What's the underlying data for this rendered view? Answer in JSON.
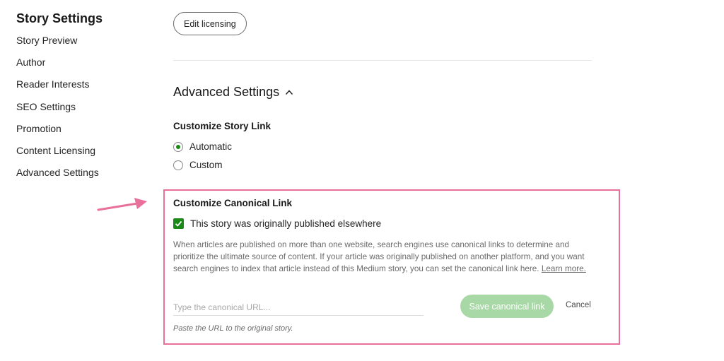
{
  "sidebar": {
    "title": "Story Settings",
    "items": [
      {
        "label": "Story Preview"
      },
      {
        "label": "Author"
      },
      {
        "label": "Reader Interests"
      },
      {
        "label": "SEO Settings"
      },
      {
        "label": "Promotion"
      },
      {
        "label": "Content Licensing"
      },
      {
        "label": "Advanced Settings"
      }
    ]
  },
  "main": {
    "edit_licensing_label": "Edit licensing",
    "advanced_settings_title": "Advanced Settings",
    "customize_story_link": {
      "title": "Customize Story Link",
      "options": [
        {
          "label": "Automatic",
          "selected": true
        },
        {
          "label": "Custom",
          "selected": false
        }
      ]
    },
    "canonical": {
      "title": "Customize Canonical Link",
      "checkbox_label": "This story was originally published elsewhere",
      "checkbox_checked": true,
      "description": "When articles are published on more than one website, search engines use canonical links to determine and prioritize the ultimate source of content. If your article was originally published on another platform, and you want search engines to index that article instead of this Medium story, you can set the canonical link here.",
      "learn_more": "Learn more.",
      "input_placeholder": "Type the canonical URL...",
      "input_value": "",
      "save_label": "Save canonical link",
      "cancel_label": "Cancel",
      "help_text": "Paste the URL to the original story."
    }
  },
  "colors": {
    "accent_green": "#1a8917",
    "save_button_disabled": "#a8d8a6",
    "highlight_pink": "#e8709a"
  },
  "icons": {
    "section_toggle": "chevron-up-icon",
    "checkbox": "checkmark-icon",
    "annotation": "arrow-right-icon"
  }
}
